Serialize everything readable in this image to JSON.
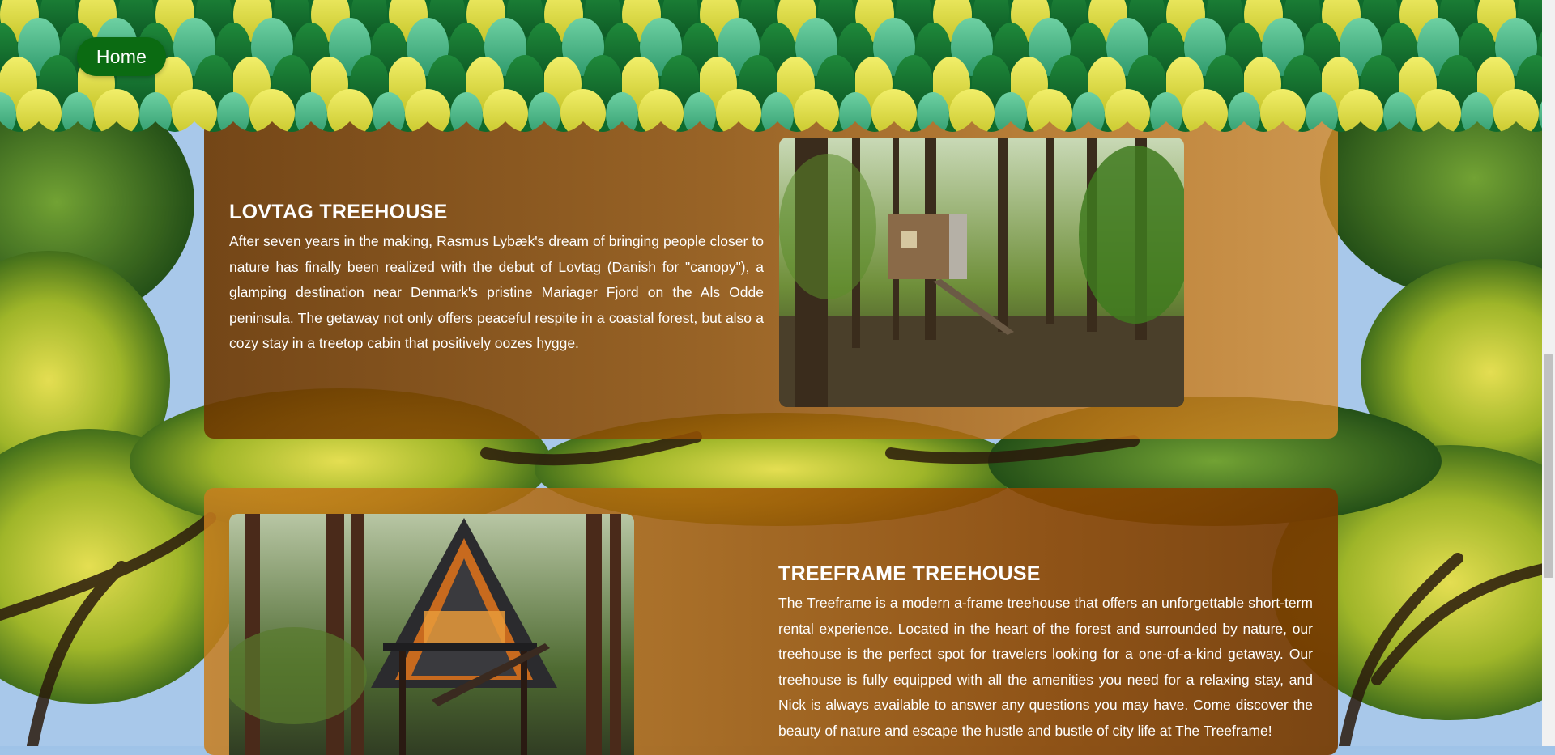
{
  "nav": {
    "home_label": "Home"
  },
  "cards": [
    {
      "title": "LOVTAG TREEHOUSE",
      "body": "After seven years in the making, Rasmus Lybæk's dream of bringing people closer to nature has finally been realized with the debut of Lovtag (Danish for \"canopy\"), a glamping destination near Denmark's pristine Mariager Fjord on the Als Odde peninsula. The getaway not only offers peaceful respite in a coastal forest, but also a cozy stay in a treetop cabin that positively oozes hygge.",
      "image_alt": "Modern cabin on stilts in a forest"
    },
    {
      "title": "TREEFRAME TREEHOUSE",
      "body": "The Treeframe is a modern a-frame treehouse that offers an unforgettable short-term rental experience. Located in the heart of the forest and surrounded by nature, our treehouse is the perfect spot for travelers looking for a one-of-a-kind getaway. Our treehouse is fully equipped with all the amenities you need for a relaxing stay, and Nick is always available to answer any questions you may have. Come discover the beauty of nature and escape the hustle and bustle of city life at The Treeframe!",
      "image_alt": "A-frame treehouse among tall trees"
    }
  ],
  "colors": {
    "home_button": "#0b6b12",
    "card_dark": "#6e3800",
    "card_light": "#d68a28",
    "text": "#ffffff"
  }
}
